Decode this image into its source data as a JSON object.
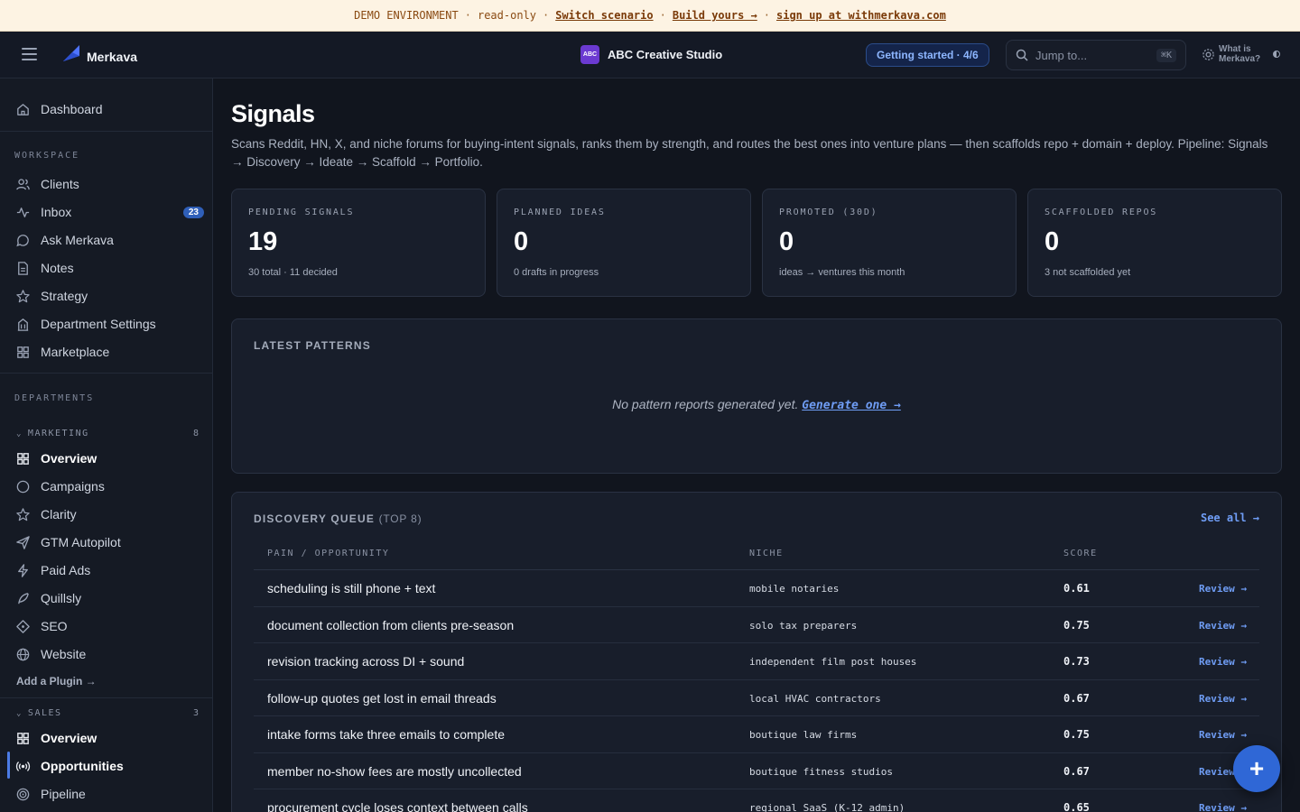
{
  "banner": {
    "label": "DEMO ENVIRONMENT",
    "mode": "read-only",
    "switch_link": "Switch scenario",
    "build_link": "Build yours →",
    "signup_link": "sign up at withmerkava.com",
    "separator": "·"
  },
  "header": {
    "app_name": "Merkava",
    "org_avatar": "ABC",
    "org_name": "ABC Creative Studio",
    "getting_started": "Getting started · 4/6",
    "search_placeholder": "Jump to...",
    "search_shortcut": "⌘K",
    "what_is": "What is Merkava?"
  },
  "sidebar": {
    "dashboard": "Dashboard",
    "workspace_label": "WORKSPACE",
    "workspace_items": [
      {
        "label": "Clients",
        "icon": "users-icon"
      },
      {
        "label": "Inbox",
        "icon": "activity-icon",
        "badge": "23"
      },
      {
        "label": "Ask Merkava",
        "icon": "chat-icon"
      },
      {
        "label": "Notes",
        "icon": "document-icon"
      },
      {
        "label": "Strategy",
        "icon": "star-icon"
      },
      {
        "label": "Department Settings",
        "icon": "building-icon"
      },
      {
        "label": "Marketplace",
        "icon": "grid-icon"
      }
    ],
    "departments_label": "DEPARTMENTS",
    "marketing": {
      "label": "MARKETING",
      "count": "8",
      "items": [
        {
          "label": "Overview",
          "icon": "grid-icon"
        },
        {
          "label": "Campaigns",
          "icon": "circle-icon"
        },
        {
          "label": "Clarity",
          "icon": "star-icon"
        },
        {
          "label": "GTM Autopilot",
          "icon": "send-icon"
        },
        {
          "label": "Paid Ads",
          "icon": "bolt-icon"
        },
        {
          "label": "Quillsly",
          "icon": "quill-icon"
        },
        {
          "label": "SEO",
          "icon": "diamond-icon"
        },
        {
          "label": "Website",
          "icon": "globe-icon"
        }
      ],
      "add_plugin": "Add a Plugin →"
    },
    "sales": {
      "label": "SALES",
      "count": "3",
      "items": [
        {
          "label": "Overview",
          "icon": "grid-icon"
        },
        {
          "label": "Opportunities",
          "icon": "broadcast-icon"
        },
        {
          "label": "Pipeline",
          "icon": "target-icon"
        }
      ]
    }
  },
  "page": {
    "title": "Signals",
    "description": "Scans Reddit, HN, X, and niche forums for buying-intent signals, ranks them by strength, and routes the best ones into venture plans — then scaffolds repo + domain + deploy. Pipeline: Signals → Discovery → Ideate → Scaffold → Portfolio."
  },
  "stats": [
    {
      "label": "PENDING SIGNALS",
      "value": "19",
      "sub": "30 total · 11 decided"
    },
    {
      "label": "PLANNED IDEAS",
      "value": "0",
      "sub": "0 drafts in progress"
    },
    {
      "label": "PROMOTED (30D)",
      "value": "0",
      "sub": "ideas → ventures this month"
    },
    {
      "label": "SCAFFOLDED REPOS",
      "value": "0",
      "sub": "3 not scaffolded yet"
    }
  ],
  "patterns": {
    "title": "LATEST PATTERNS",
    "empty": "No pattern reports generated yet.",
    "generate_link": "Generate one →"
  },
  "queue": {
    "title": "DISCOVERY QUEUE",
    "subtitle": "(TOP 8)",
    "see_all": "See all →",
    "columns": {
      "pain": "PAIN / OPPORTUNITY",
      "niche": "NICHE",
      "score": "SCORE"
    },
    "review_label": "Review →",
    "rows": [
      {
        "pain": "scheduling is still phone + text",
        "niche": "mobile notaries",
        "score": "0.61"
      },
      {
        "pain": "document collection from clients pre-season",
        "niche": "solo tax preparers",
        "score": "0.75"
      },
      {
        "pain": "revision tracking across DI + sound",
        "niche": "independent film post houses",
        "score": "0.73"
      },
      {
        "pain": "follow-up quotes get lost in email threads",
        "niche": "local HVAC contractors",
        "score": "0.67"
      },
      {
        "pain": "intake forms take three emails to complete",
        "niche": "boutique law firms",
        "score": "0.75"
      },
      {
        "pain": "member no-show fees are mostly uncollected",
        "niche": "boutique fitness studios",
        "score": "0.67"
      },
      {
        "pain": "procurement cycle loses context between calls",
        "niche": "regional SaaS (K-12 admin)",
        "score": "0.65"
      }
    ]
  },
  "fab_label": "+"
}
